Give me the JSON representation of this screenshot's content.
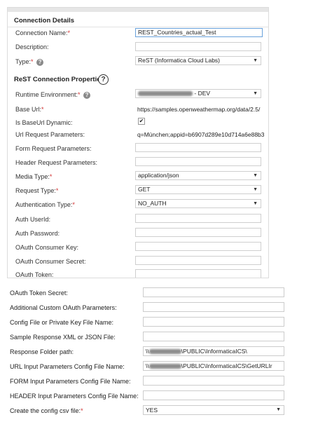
{
  "connection_details": {
    "heading": "Connection Details",
    "name_label": "Connection Name:",
    "name_value": "REST_Countries_actual_Test",
    "description_label": "Description:",
    "description_value": "",
    "type_label": "Type:",
    "type_value": "ReST (Informatica Cloud Labs)"
  },
  "rest_properties": {
    "heading": "ReST Connection Properties",
    "runtime_env_label": "Runtime Environment:",
    "runtime_env_value": "- DEV",
    "base_url_label": "Base Url:",
    "base_url_value": "https://samples.openweathermap.org/data/2.5/",
    "is_baseurl_dynamic_label": "Is BaseUrl Dynamic:",
    "is_baseurl_dynamic_checked": true,
    "url_params_label": "Url Request Parameters:",
    "url_params_value": "q=München;appid=b6907d289e10d714a6e88b3",
    "form_params_label": "Form Request Parameters:",
    "form_params_value": "",
    "header_params_label": "Header Request Parameters:",
    "header_params_value": "",
    "media_type_label": "Media Type:",
    "media_type_value": "application/json",
    "request_type_label": "Request Type:",
    "request_type_value": "GET",
    "auth_type_label": "Authentication Type:",
    "auth_type_value": "NO_AUTH",
    "auth_userid_label": "Auth UserId:",
    "auth_password_label": "Auth Password:",
    "oauth_consumer_key_label": "OAuth Consumer Key:",
    "oauth_consumer_secret_label": "OAuth Consumer Secret:",
    "oauth_token_label": "OAuth Token:"
  },
  "lower_section": {
    "oauth_token_secret_label": "OAuth Token Secret:",
    "additional_oauth_label": "Additional Custom OAuth Parameters:",
    "config_key_label": "Config File or Private Key File Name:",
    "sample_response_label": "Sample Response XML or JSON File:",
    "response_folder_label": "Response Folder path:",
    "response_folder_prefix": "\\\\",
    "response_folder_suffix": "\\PUBLIC\\InformaticaICS\\",
    "url_config_label": "URL Input Parameters Config File Name:",
    "url_config_prefix": "\\\\",
    "url_config_suffix": "\\PUBLIC\\InformaticaICS\\GetURLIr",
    "form_config_label": "FORM Input Parameters Config File Name:",
    "header_config_label": "HEADER Input Parameters Config File Name:",
    "create_csv_label": "Create the config csv file:",
    "create_csv_value": "YES"
  },
  "icons": {
    "help": "help-circle-icon",
    "dropdown": "chevron-down-icon",
    "check": "checkmark-icon"
  },
  "colors": {
    "required": "#d03030",
    "active_border": "#6aa2dc"
  }
}
